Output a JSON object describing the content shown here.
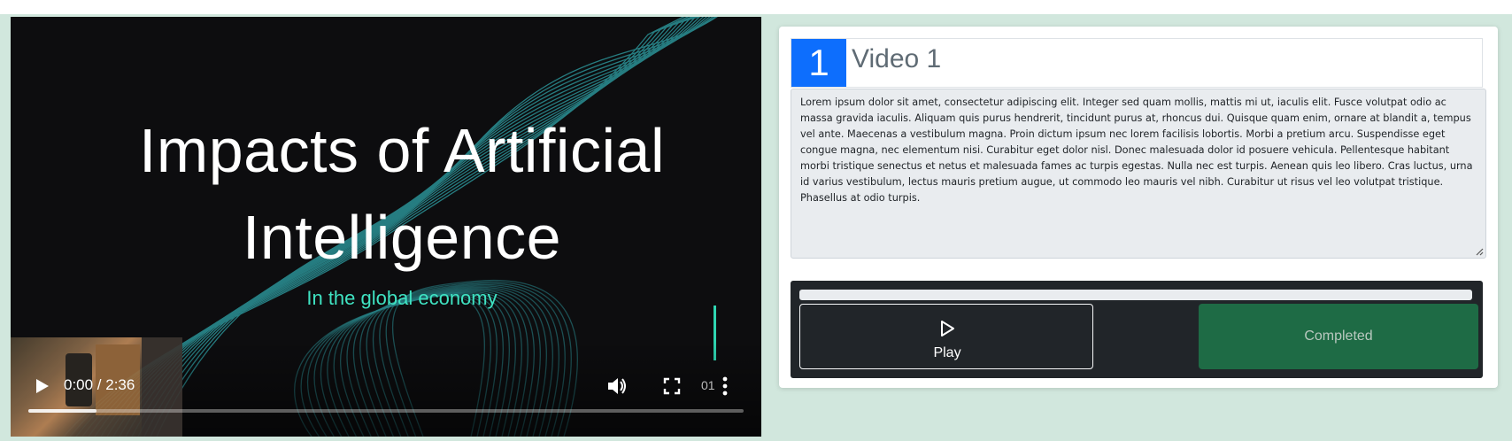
{
  "video": {
    "slide_title_line1": "Impacts of Artificial",
    "slide_title_line2": "Intelligence",
    "slide_subtitle": "In the global economy",
    "time_display": "0:00 / 2:36",
    "menu_label": "01",
    "progress_fraction": 0.095
  },
  "item": {
    "number": "1",
    "title": "Video 1",
    "description": "Lorem ipsum dolor sit amet, consectetur adipiscing elit. Integer sed quam mollis, mattis mi ut, iaculis elit. Fusce volutpat odio ac massa gravida iaculis. Aliquam quis purus hendrerit, tincidunt purus at, rhoncus dui. Quisque quam enim, ornare at blandit a, tempus vel ante. Maecenas a vestibulum magna. Proin dictum ipsum nec lorem facilisis lobortis. Morbi a pretium arcu. Suspendisse eget congue magna, nec elementum nisi. Curabitur eget dolor nisl. Donec malesuada dolor id posuere vehicula. Pellentesque habitant morbi tristique senectus et netus et malesuada fames ac turpis egestas. Nulla nec est turpis. Aenean quis leo libero. Cras luctus, urna id varius vestibulum, lectus mauris pretium augue, ut commodo leo mauris vel nibh. Curabitur ut risus vel leo volutpat tristique. Phasellus at odio turpis.",
    "progress_fraction": 0,
    "play_label": "Play",
    "completed_label": "Completed"
  },
  "colors": {
    "page_bg": "#d1e7dd",
    "number_badge": "#0d6efd",
    "panel_bg": "#212529",
    "completed_bg": "#1e6b45",
    "accent_teal": "#3fe3c2"
  },
  "icons": [
    "play-icon",
    "volume-icon",
    "fullscreen-icon",
    "more-vertical-icon",
    "play-outline-icon",
    "resize-grip-icon"
  ]
}
